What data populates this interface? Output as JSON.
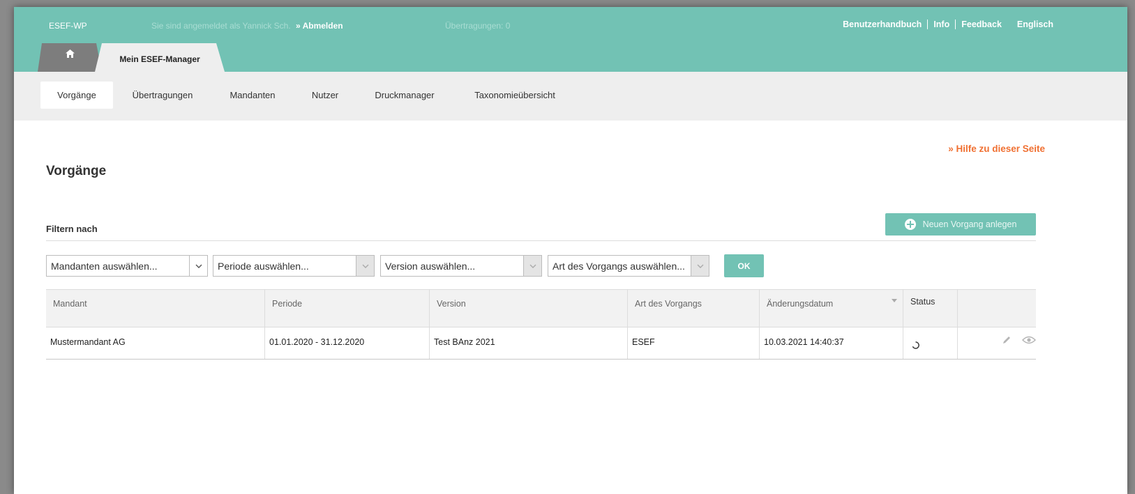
{
  "header": {
    "app_name": "ESEF-WP",
    "login_text": "Sie sind angemeldet als Yannick Sch.",
    "logout_label": "» Abmelden",
    "transfers_text": "Übertragungen: 0",
    "links": [
      "Benutzerhandbuch",
      "Info",
      "Feedback",
      "Englisch"
    ],
    "home_tab_icon": "home-icon",
    "main_tab_label": "Mein ESEF-Manager"
  },
  "subnav": {
    "items": [
      "Vorgänge",
      "Übertragungen",
      "Mandanten",
      "Nutzer",
      "Druckmanager",
      "Taxonomieübersicht"
    ],
    "active": "Vorgänge"
  },
  "page": {
    "help_link": "» Hilfe zu dieser Seite",
    "title": "Vorgänge",
    "filter_title": "Filtern nach",
    "new_button": "Neuen Vorgang anlegen"
  },
  "filters": {
    "client": "Mandanten auswählen...",
    "period": "Periode auswählen...",
    "version": "Version auswählen...",
    "type": "Art des Vorgangs auswählen...",
    "ok_label": "OK"
  },
  "table": {
    "columns": [
      "Mandant",
      "Periode",
      "Version",
      "Art des Vorgangs",
      "Änderungsdatum",
      "Status"
    ],
    "rows": [
      {
        "client": "Mustermandant AG",
        "period": "01.01.2020 - 31.12.2020",
        "version": "Test BAnz 2021",
        "type": "ESEF",
        "changed": "10.03.2021 14:40:37",
        "status_icon": "loading-spinner-icon"
      }
    ]
  },
  "colors": {
    "accent": "#72c2b4",
    "help_link": "#f07032",
    "subnav_bg": "#eeeeee"
  }
}
